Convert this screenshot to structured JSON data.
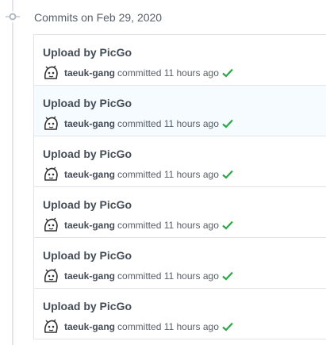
{
  "group": {
    "title": "Commits on Feb 29, 2020",
    "icon": "git-commit-icon"
  },
  "colors": {
    "success": "#28a745",
    "highlight_row": "#f6fbff",
    "border": "#e1e4e8"
  },
  "commits": [
    {
      "title": "Upload by PicGo",
      "author": "taeuk-gang",
      "action": "committed",
      "time": "11 hours ago",
      "status": "check-icon"
    },
    {
      "title": "Upload by PicGo",
      "author": "taeuk-gang",
      "action": "committed",
      "time": "11 hours ago",
      "status": "check-icon"
    },
    {
      "title": "Upload by PicGo",
      "author": "taeuk-gang",
      "action": "committed",
      "time": "11 hours ago",
      "status": "check-icon"
    },
    {
      "title": "Upload by PicGo",
      "author": "taeuk-gang",
      "action": "committed",
      "time": "11 hours ago",
      "status": "check-icon"
    },
    {
      "title": "Upload by PicGo",
      "author": "taeuk-gang",
      "action": "committed",
      "time": "11 hours ago",
      "status": "check-icon"
    },
    {
      "title": "Upload by PicGo",
      "author": "taeuk-gang",
      "action": "committed",
      "time": "11 hours ago",
      "status": "check-icon"
    }
  ]
}
